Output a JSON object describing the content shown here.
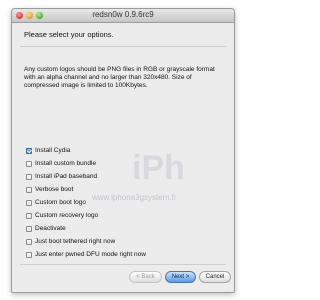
{
  "window": {
    "title": "redsn0w 0.9.6rc9"
  },
  "prompt": "Please select your options.",
  "description": "Any custom logos should be PNG files in RGB or grayscale format with an alpha channel and no larger than 320x480. Size of compressed image is limited to 100Kbytes.",
  "options": [
    {
      "label": "Install Cydia",
      "checked": true
    },
    {
      "label": "Install custom bundle",
      "checked": false
    },
    {
      "label": "Install iPad baseband",
      "checked": false
    },
    {
      "label": "Verbose boot",
      "checked": false
    },
    {
      "label": "Custom boot logo",
      "checked": false
    },
    {
      "label": "Custom recovery logo",
      "checked": false
    },
    {
      "label": "Deactivate",
      "checked": false
    },
    {
      "label": "Just boot tethered right now",
      "checked": false
    },
    {
      "label": "Just enter pwned DFU mode right now",
      "checked": false
    }
  ],
  "watermark": {
    "brand": "iPh",
    "url": "www.iphone3gsystem.fr"
  },
  "buttons": {
    "back": "< Back",
    "next": "Next >",
    "cancel": "Cancel"
  }
}
